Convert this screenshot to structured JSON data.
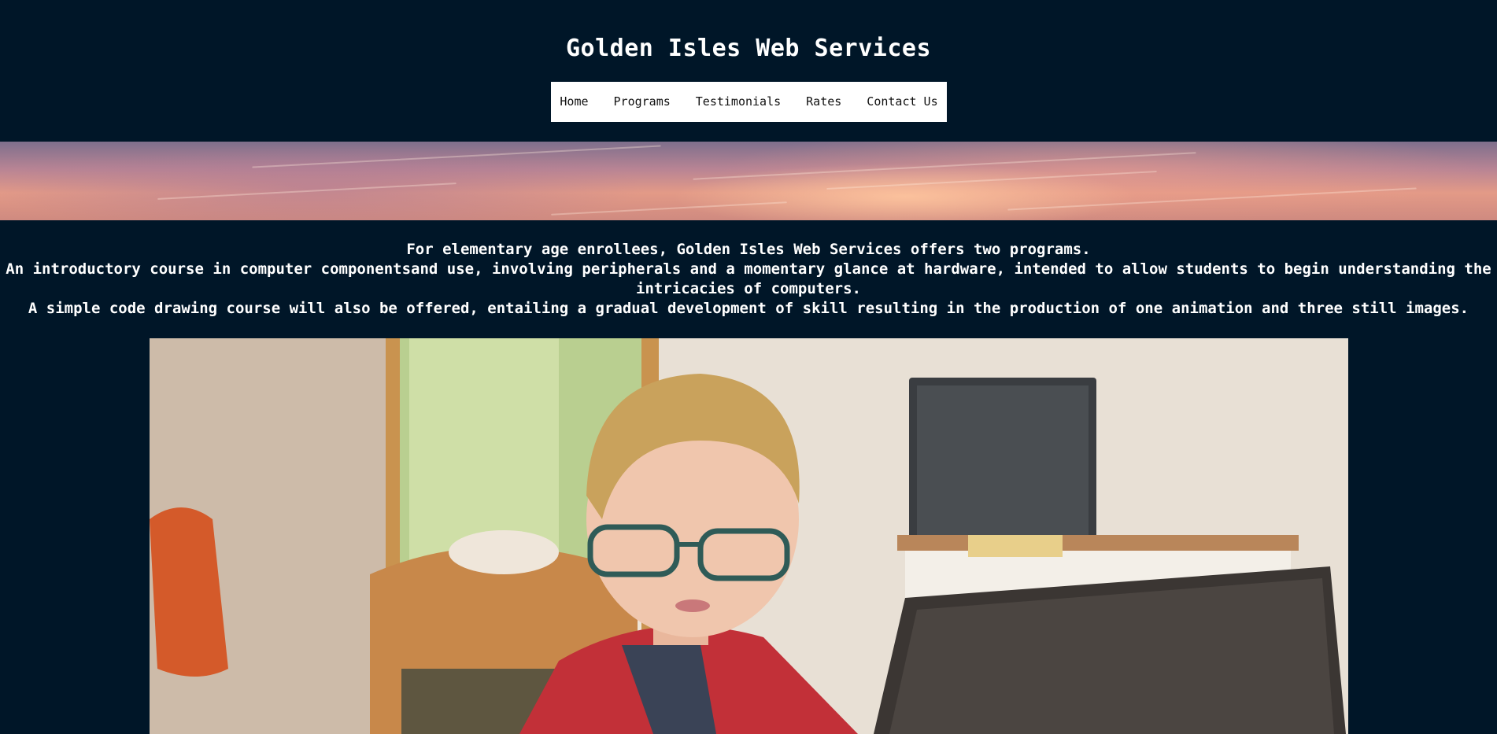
{
  "header": {
    "title": "Golden Isles Web Services"
  },
  "nav": {
    "items": [
      {
        "label": "Home"
      },
      {
        "label": "Programs"
      },
      {
        "label": "Testimonials"
      },
      {
        "label": "Rates"
      },
      {
        "label": "Contact Us"
      }
    ]
  },
  "intro": {
    "line1": "For elementary age enrollees, Golden Isles Web Services offers two programs.",
    "line2": "An introductory course in computer componentsand use, involving peripherals and a momentary glance at hardware, intended to allow students to begin understanding the intricacies of computers.",
    "line3": "A simple code drawing course will also be offered, entailing a gradual development of skill resulting in the production of one animation and three still images."
  },
  "colors": {
    "background": "#001628",
    "nav_background": "#ffffff",
    "nav_text": "#111111",
    "text": "#ffffff"
  }
}
